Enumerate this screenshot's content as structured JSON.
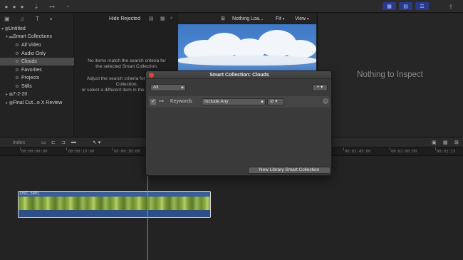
{
  "toolbar": {
    "hide_rejected_label": "Hide Rejected",
    "viewer_title": "Nothing Loa...",
    "fit_label": "Fit",
    "view_label": "View"
  },
  "library": {
    "items": [
      {
        "label": "Untitled",
        "glyph": "▾ ▦"
      },
      {
        "label": "Smart Collections",
        "glyph": "▾ ▬"
      },
      {
        "label": "All Video",
        "glyph": "⚙"
      },
      {
        "label": "Audio Only",
        "glyph": "⚙"
      },
      {
        "label": "Clouds",
        "glyph": "⚙"
      },
      {
        "label": "Favorites",
        "glyph": "⚙"
      },
      {
        "label": "Projects",
        "glyph": "⚙"
      },
      {
        "label": "Stills",
        "glyph": "⚙"
      },
      {
        "label": "7-2-20",
        "glyph": "▸ ▦"
      },
      {
        "label": "Final Cut...o X Review",
        "glyph": "▸ ▦"
      }
    ],
    "selected": "Clouds"
  },
  "browser": {
    "empty_line1": "No items match the search criteria for",
    "empty_line2": "the selected Smart Collection.",
    "empty_line3": "Adjust the search criteria for the Smart",
    "empty_line4": "Collection,",
    "empty_line5": "or select a different item in the Libraries list."
  },
  "inspector": {
    "empty_text": "Nothing to Inspect"
  },
  "timeline": {
    "index_label": "Index",
    "ticks": [
      "00:00:00:00",
      "00:00:15:00",
      "00:00:30:00",
      "00:01:45:00",
      "00:02:00:00",
      "00:02:15"
    ],
    "clip_name": "DSC_5901"
  },
  "dialog": {
    "title": "Smart Collection: Clouds",
    "match_value": "All",
    "rule_label": "Keywords",
    "rule_operator": "Include Any",
    "footer_button": "New Library Smart Collection"
  },
  "colors": {
    "accent": "#2a3a8a",
    "selection": "#4a4a4a",
    "close_button": "#e0443e"
  }
}
